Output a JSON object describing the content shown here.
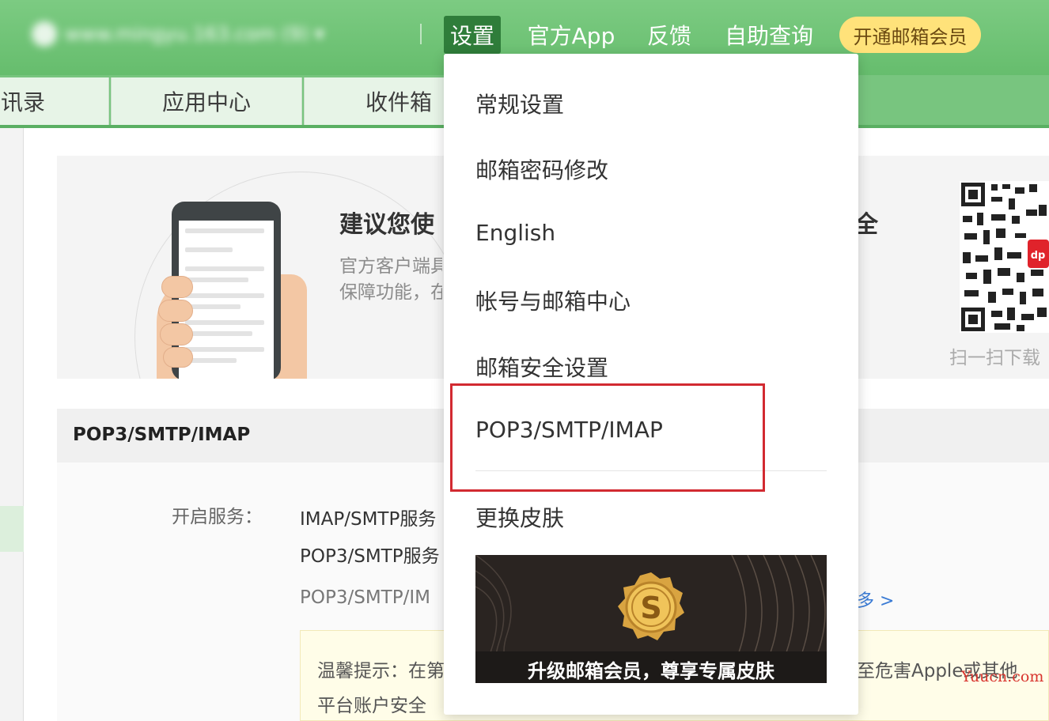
{
  "topbar": {
    "account_text": "www.mingyu.163.com (9) ▾",
    "nav": {
      "settings": "设置",
      "official_app": "官方App",
      "feedback": "反馈",
      "self_help": "自助查询"
    },
    "vip_button": "开通邮箱会员"
  },
  "subnav": {
    "contacts": "讯录",
    "apps": "应用中心",
    "inbox": "收件箱"
  },
  "promo": {
    "title": "建议您使",
    "title_end": "全",
    "desc_line1": "官方客户端具",
    "desc_line2": "保障功能，在",
    "qr_caption": "扫一扫下载"
  },
  "section": {
    "title": "POP3/SMTP/IMAP",
    "service_label": "开启服务：",
    "service_imap": "IMAP/SMTP服务",
    "service_pop3": "POP3/SMTP服务",
    "service_desc": "POP3/SMTP/IM",
    "more_link": "多 >",
    "tip_line1": "温馨提示：在第",
    "tip_line1_end": "至危害Apple或其他",
    "tip_line2": "平台账户安全"
  },
  "dropdown": {
    "items": [
      "常规设置",
      "邮箱密码修改",
      "English",
      "帐号与邮箱中心",
      "邮箱安全设置",
      "POP3/SMTP/IMAP",
      "更换皮肤"
    ],
    "skin_banner": "升级邮箱会员，尊享专属皮肤"
  },
  "watermark": "Yuucn.com",
  "colors": {
    "topbar": "#6fc476",
    "settings_active": "#2f7d3a",
    "vip": "#ffe27a",
    "highlight_border": "#d22a31",
    "link": "#3a7bd5"
  }
}
